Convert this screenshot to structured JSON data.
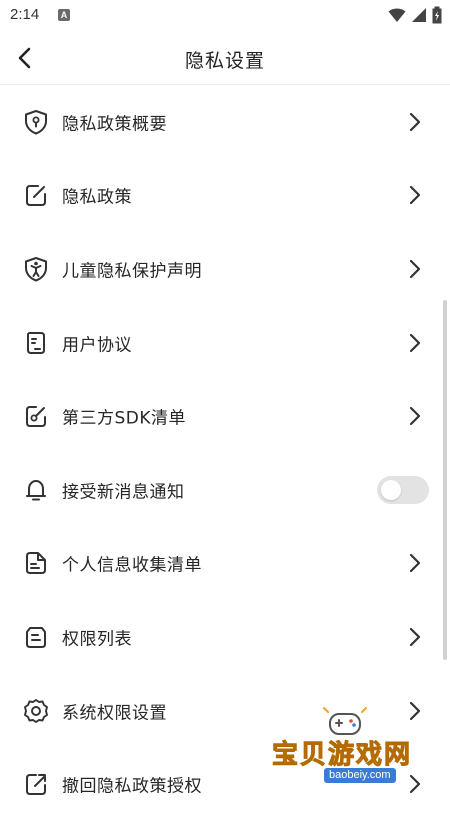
{
  "status_bar": {
    "time": "2:14",
    "notification_badge": "A",
    "icons": [
      "wifi-icon",
      "signal-icon",
      "battery-icon"
    ]
  },
  "header": {
    "back_icon": "chevron-left-icon",
    "title": "隐私设置"
  },
  "items": [
    {
      "icon": "shield-lock-icon",
      "label": "隐私政策概要",
      "control": "chevron"
    },
    {
      "icon": "edit-note-icon",
      "label": "隐私政策",
      "control": "chevron"
    },
    {
      "icon": "child-shield-icon",
      "label": "儿童隐私保护声明",
      "control": "chevron"
    },
    {
      "icon": "agreement-doc-icon",
      "label": "用户协议",
      "control": "chevron"
    },
    {
      "icon": "sdk-edit-icon",
      "label": "第三方SDK清单",
      "control": "chevron"
    },
    {
      "icon": "bell-icon",
      "label": "接受新消息通知",
      "control": "toggle",
      "toggle_on": false
    },
    {
      "icon": "document-list-icon",
      "label": "个人信息收集清单",
      "control": "chevron"
    },
    {
      "icon": "permission-list-icon",
      "label": "权限列表",
      "control": "chevron"
    },
    {
      "icon": "gear-icon",
      "label": "系统权限设置",
      "control": "chevron"
    },
    {
      "icon": "external-link-icon",
      "label": "撤回隐私政策授权",
      "control": "chevron"
    }
  ],
  "watermark": {
    "text": "宝贝游戏网",
    "url": "baobeiy.com"
  },
  "colors": {
    "background": "#ffffff",
    "text": "#262626",
    "toggle_off": "#e3e3e3",
    "watermark": "#f2a51e"
  }
}
